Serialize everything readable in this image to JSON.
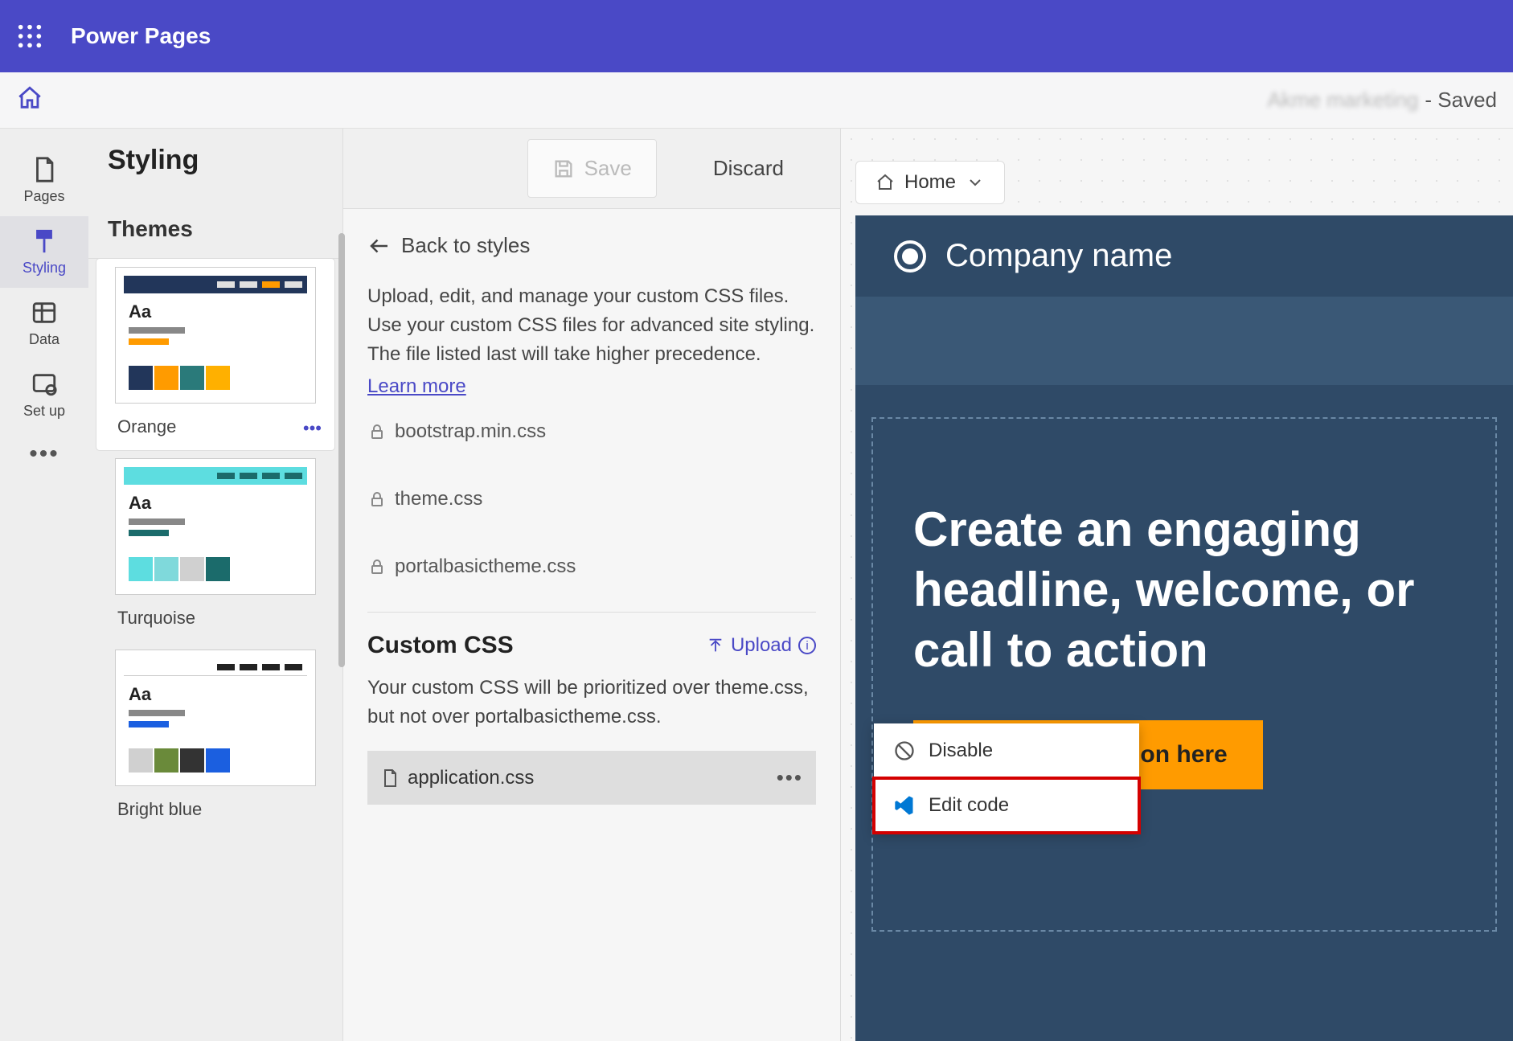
{
  "header": {
    "app_title": "Power Pages"
  },
  "subheader": {
    "site_name": "Akme marketing",
    "status": "- Saved"
  },
  "left_nav": {
    "items": [
      {
        "label": "Pages"
      },
      {
        "label": "Styling"
      },
      {
        "label": "Data"
      },
      {
        "label": "Set up"
      }
    ]
  },
  "styling_panel": {
    "title": "Styling",
    "save_label": "Save",
    "discard_label": "Discard",
    "themes_title": "Themes",
    "themes": [
      {
        "name": "Orange"
      },
      {
        "name": "Turquoise"
      },
      {
        "name": "Bright blue"
      }
    ]
  },
  "css_panel": {
    "back_label": "Back to styles",
    "description": "Upload, edit, and manage your custom CSS files. Use your custom CSS files for advanced site styling. The file listed last will take higher precedence.",
    "learn_more": "Learn more",
    "system_files": [
      "bootstrap.min.css",
      "theme.css",
      "portalbasictheme.css"
    ],
    "custom_title": "Custom CSS",
    "upload_label": "Upload",
    "custom_description": "Your custom CSS will be prioritized over theme.css, but not over portalbasictheme.css.",
    "custom_file": "application.css",
    "context_menu": {
      "disable": "Disable",
      "edit_code": "Edit code"
    }
  },
  "preview": {
    "breadcrumb": "Home",
    "company": "Company name",
    "headline": "Create an engaging headline, welcome, or call to action",
    "cta": "Add a call to action here"
  }
}
